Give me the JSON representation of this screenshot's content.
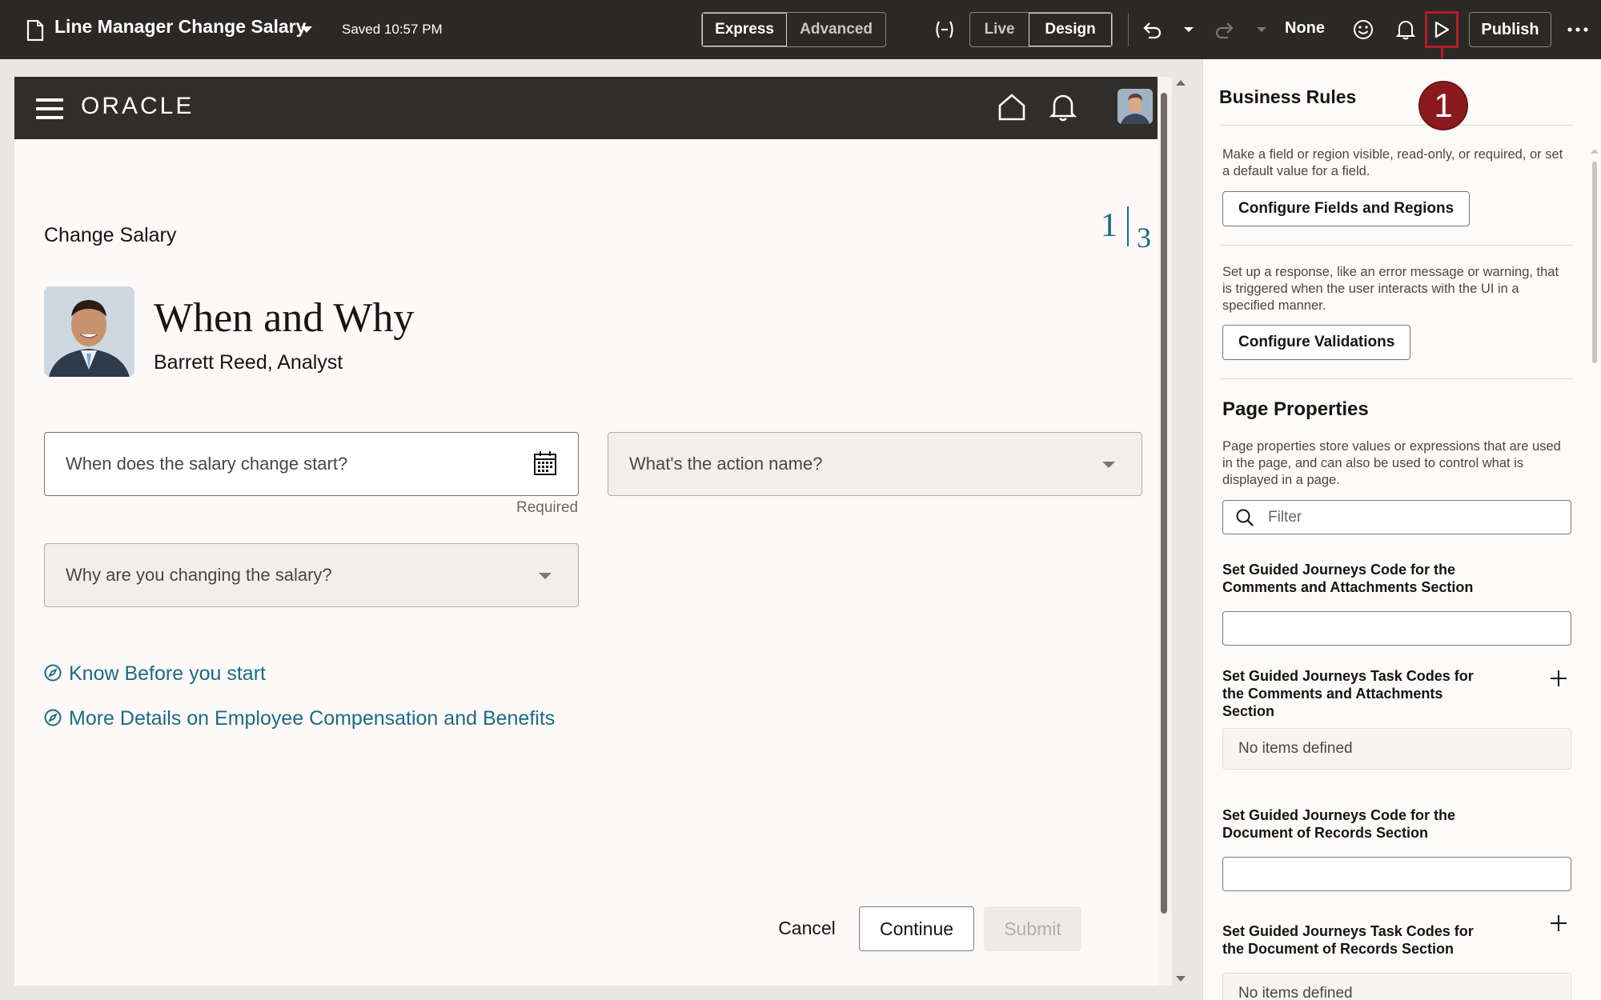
{
  "toolbar": {
    "app_title": "Line Manager Change Salary",
    "saved_status": "Saved 10:57 PM",
    "mode_options": [
      "Express",
      "Advanced"
    ],
    "view_options": [
      "Live",
      "Design"
    ],
    "sandbox_label": "None",
    "publish_label": "Publish",
    "icons": [
      "file-icon",
      "expression-icon",
      "undo-icon",
      "redo-icon",
      "smiley-icon",
      "bell-icon",
      "play-icon",
      "more-icon"
    ]
  },
  "marker": {
    "label": "1",
    "color": "#8b1a1f"
  },
  "preview": {
    "logo": "ORACLE",
    "page_title": "Change Salary",
    "step_current": "1",
    "step_total": "3",
    "section_heading": "When and Why",
    "person_name": "Barrett Reed, Analyst",
    "fields": {
      "start_date_placeholder": "When does the salary change start?",
      "required_hint": "Required",
      "action_name_placeholder": "What's the action name?",
      "reason_placeholder": "Why are you changing the salary?"
    },
    "links": [
      "Know Before you start",
      "More Details on Employee Compensation and Benefits"
    ],
    "buttons": {
      "cancel": "Cancel",
      "continue": "Continue",
      "submit": "Submit"
    }
  },
  "panel": {
    "business_rules_title": "Business Rules",
    "fields_regions_desc": "Make a field or region visible, read-only, or required, or set a default value for a field.",
    "configure_fields_label": "Configure Fields and Regions",
    "validations_desc": "Set up a response, like an error message or warning, that is triggered when the user interacts with the UI in a specified manner.",
    "configure_validations_label": "Configure Validations",
    "page_properties_title": "Page Properties",
    "page_properties_desc": "Page properties store values or expressions that are used in the page, and can also be used to control what is displayed in a page.",
    "filter_placeholder": "Filter",
    "properties": [
      {
        "label": "Set Guided Journeys Code for the Comments and Attachments Section",
        "kind": "input",
        "value": ""
      },
      {
        "label": "Set Guided Journeys Task Codes for the Comments and Attachments Section",
        "kind": "list",
        "empty_text": "No items defined"
      },
      {
        "label": "Set Guided Journeys Code for the Document of Records Section",
        "kind": "input",
        "value": ""
      },
      {
        "label": "Set Guided Journeys Task Codes for the Document of Records Section",
        "kind": "list",
        "empty_text": "No items defined"
      }
    ]
  },
  "colors": {
    "toolbar_bg": "#2b2826",
    "oracle_header_bg": "#312d2a",
    "link": "#1d6a87",
    "highlight": "#b31c25"
  }
}
